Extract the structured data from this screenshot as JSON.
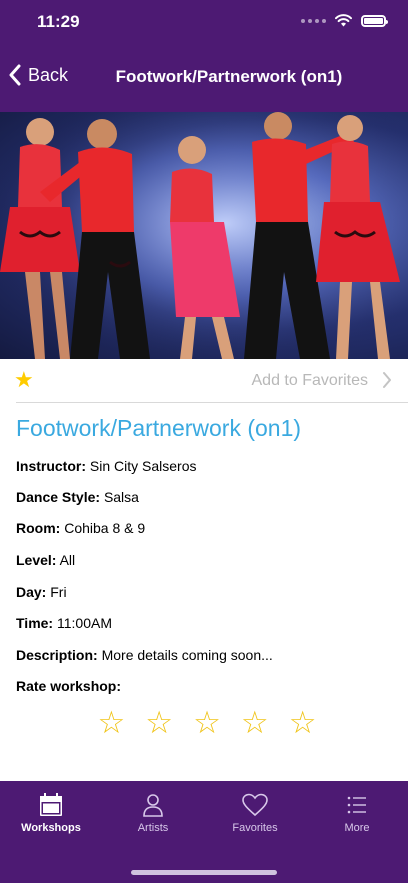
{
  "status_bar": {
    "time": "11:29"
  },
  "nav": {
    "back_label": "Back",
    "title": "Footwork/Partnerwork (on1)"
  },
  "favorites": {
    "label": "Add to Favorites",
    "star": "★"
  },
  "workshop": {
    "title": "Footwork/Partnerwork (on1)",
    "details": [
      {
        "label": "Instructor:",
        "value": "Sin City Salseros"
      },
      {
        "label": "Dance Style:",
        "value": "Salsa"
      },
      {
        "label": "Room:",
        "value": "Cohiba 8 & 9"
      },
      {
        "label": "Level:",
        "value": "All"
      },
      {
        "label": "Day:",
        "value": "Fri"
      },
      {
        "label": "Time:",
        "value": "11:00AM"
      },
      {
        "label": "Description:",
        "value": "More details coming soon..."
      }
    ],
    "rate_label": "Rate workshop:",
    "rating_stars": [
      "☆",
      "☆",
      "☆",
      "☆",
      "☆"
    ],
    "rating_value": 0
  },
  "tabs": [
    {
      "label": "Workshops",
      "icon": "calendar-icon",
      "active": true
    },
    {
      "label": "Artists",
      "icon": "person-icon",
      "active": false
    },
    {
      "label": "Favorites",
      "icon": "heart-icon",
      "active": false
    },
    {
      "label": "More",
      "icon": "list-icon",
      "active": false
    }
  ],
  "colors": {
    "brand": "#4d1a73",
    "title": "#3aa9e0",
    "star": "#ffcc00"
  }
}
